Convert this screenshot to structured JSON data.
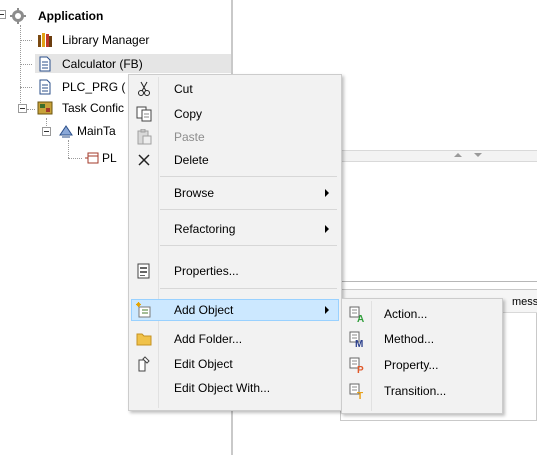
{
  "tree": {
    "root_label": "Application",
    "items": [
      {
        "label": "Library Manager",
        "icon": "library-manager-icon"
      },
      {
        "label": "Calculator (FB)",
        "icon": "pou-icon"
      },
      {
        "label": "PLC_PRG (",
        "icon": "pou-icon"
      },
      {
        "label": "Task Confic",
        "icon": "task-configuration-icon"
      },
      {
        "label": "MainTa",
        "icon": "task-icon"
      },
      {
        "label": "PL",
        "icon": "program-call-icon"
      }
    ]
  },
  "right_panel": {
    "message_header_fragment": "mess"
  },
  "context_menu": {
    "items": [
      {
        "label": "Cut",
        "icon": "scissors-icon"
      },
      {
        "label": "Copy",
        "icon": "copy-icon"
      },
      {
        "label": "Paste",
        "icon": "paste-icon",
        "disabled": true
      },
      {
        "label": "Delete",
        "icon": "delete-icon"
      },
      {
        "label": "Browse",
        "submenu": true
      },
      {
        "label": "Refactoring",
        "submenu": true
      },
      {
        "label": "Properties...",
        "icon": "properties-icon"
      },
      {
        "label": "Add Object",
        "icon": "add-object-icon",
        "submenu": true,
        "highlighted": true
      },
      {
        "label": "Add Folder...",
        "icon": "folder-icon"
      },
      {
        "label": "Edit Object",
        "icon": "edit-object-icon"
      },
      {
        "label": "Edit Object With..."
      }
    ]
  },
  "submenu": {
    "items": [
      {
        "label": "Action...",
        "icon": "action-icon",
        "letter": "A"
      },
      {
        "label": "Method...",
        "icon": "method-icon",
        "letter": "M"
      },
      {
        "label": "Property...",
        "icon": "property-icon",
        "letter": "P"
      },
      {
        "label": "Transition...",
        "icon": "transition-icon",
        "letter": "T"
      }
    ]
  },
  "colors": {
    "highlight_bg": "#cce8ff",
    "highlight_border": "#99d1ff",
    "menu_bg": "#f2f2f2",
    "action_letter": "#2f9e3a",
    "method_letter": "#2b3f8c",
    "property_letter": "#e0592a",
    "transition_letter": "#e8a11a"
  }
}
